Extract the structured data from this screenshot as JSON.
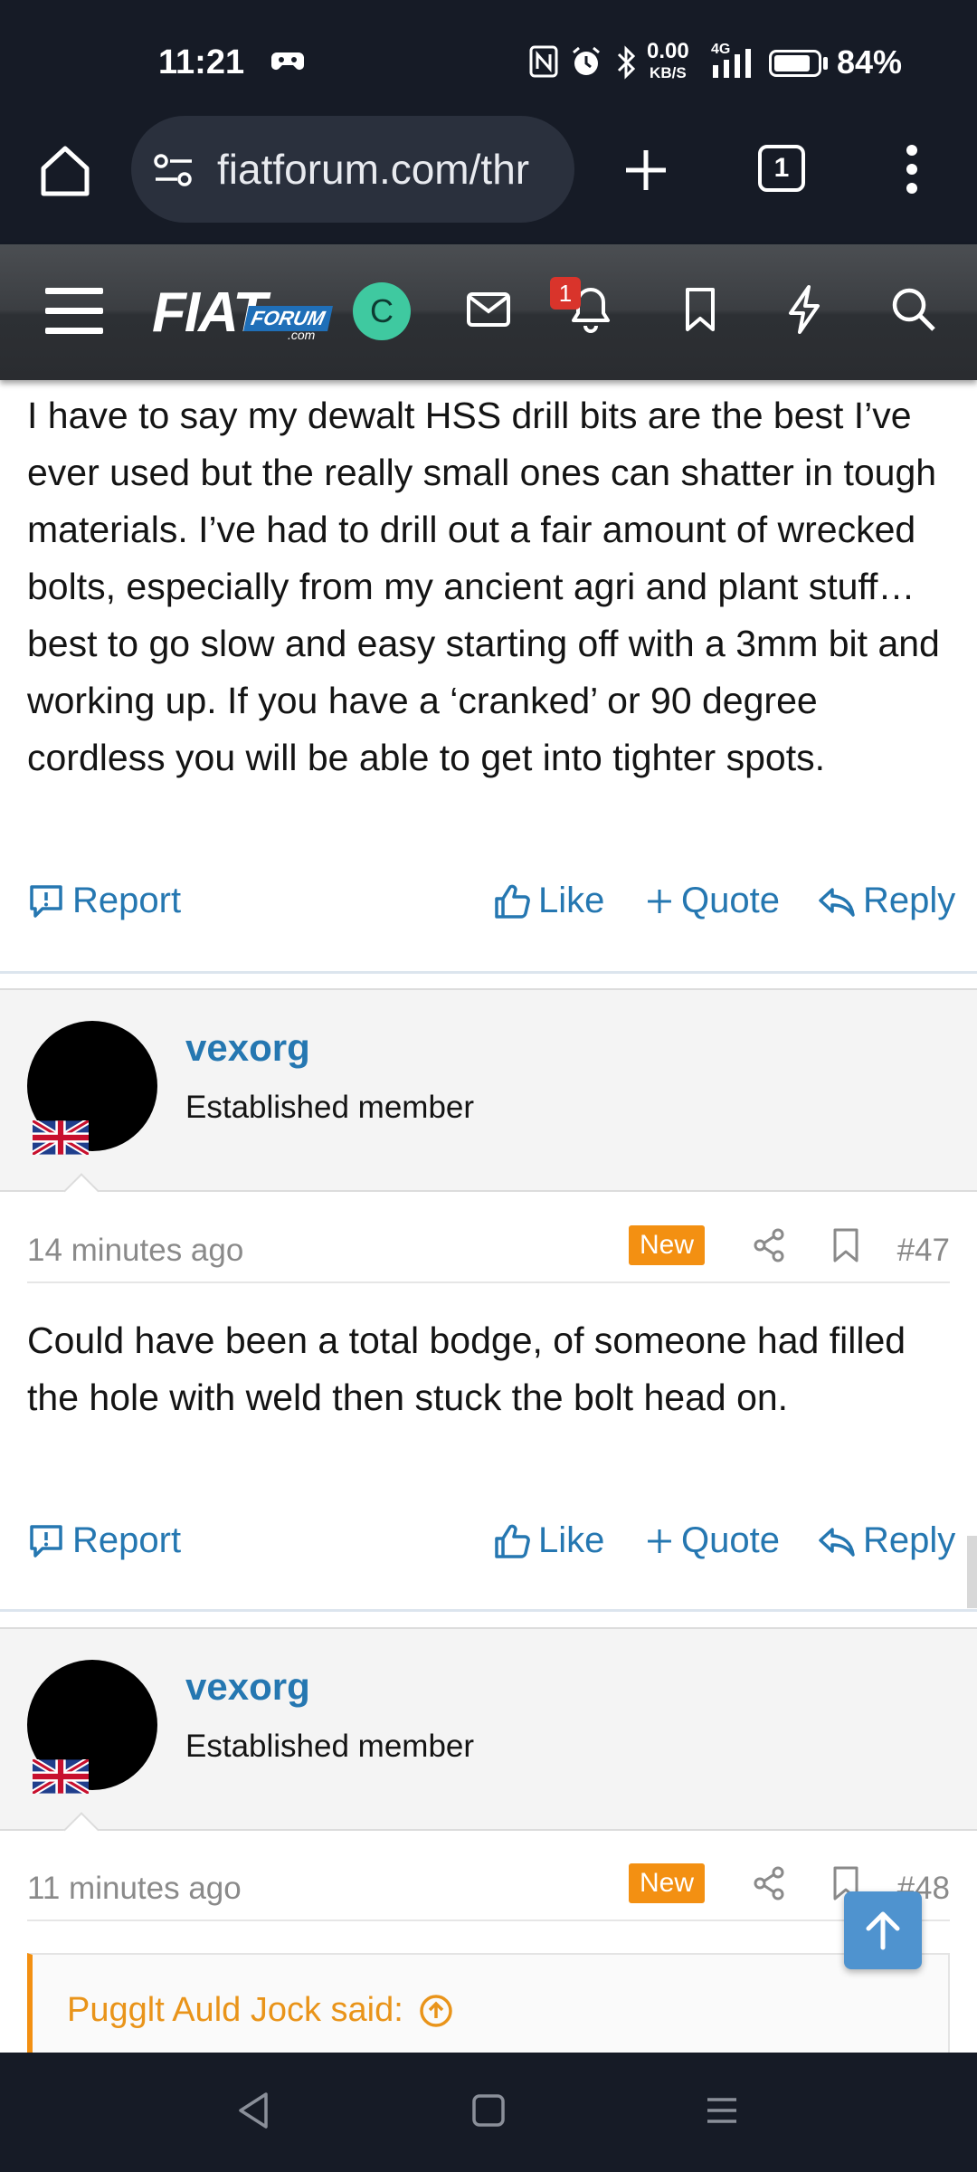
{
  "status_bar": {
    "time": "11:21",
    "net_speed": "0.00",
    "net_unit": "KB/S",
    "net_type": "4G",
    "battery_pct": "84%",
    "battery_level": 0.84
  },
  "browser": {
    "url": "fiatforum.com/thr",
    "tab_count": "1"
  },
  "forum_header": {
    "logo_main": "FIAT",
    "logo_sub": "FORUM",
    "logo_com": ".com",
    "account_initial": "C",
    "alerts_count": "1"
  },
  "posts": [
    {
      "body": "I have to say my dewalt HSS drill bits are the best I’ve ever used but the really small ones can shatter in tough materials. I’ve had to drill out a fair amount of wrecked bolts, especially from my ancient agri and plant stuff…best to go slow and easy starting off with a 3mm bit and working up. If you have a ‘cranked’ or 90 degree cordless you will be able to get into tighter spots.",
      "actions": {
        "report": "Report",
        "like": "Like",
        "quote": "Quote",
        "reply": "Reply"
      }
    },
    {
      "username": "vexorg",
      "user_title": "Established member",
      "time": "14 minutes ago",
      "badge": "New",
      "number": "#47",
      "body": "Could have been a total bodge, of someone had filled the hole with weld then stuck the bolt head on.",
      "actions": {
        "report": "Report",
        "like": "Like",
        "quote": "Quote",
        "reply": "Reply"
      }
    },
    {
      "username": "vexorg",
      "user_title": "Established member",
      "time": "11 minutes ago",
      "badge": "New",
      "number": "#48",
      "quote_header": "Pugglt Auld Jock said:"
    }
  ],
  "colors": {
    "link": "#2577b1",
    "badge_new": "#f39012",
    "chrome_bg": "#161b26",
    "avatar_c": "#3fc9a0",
    "alert_red": "#d9342b"
  }
}
